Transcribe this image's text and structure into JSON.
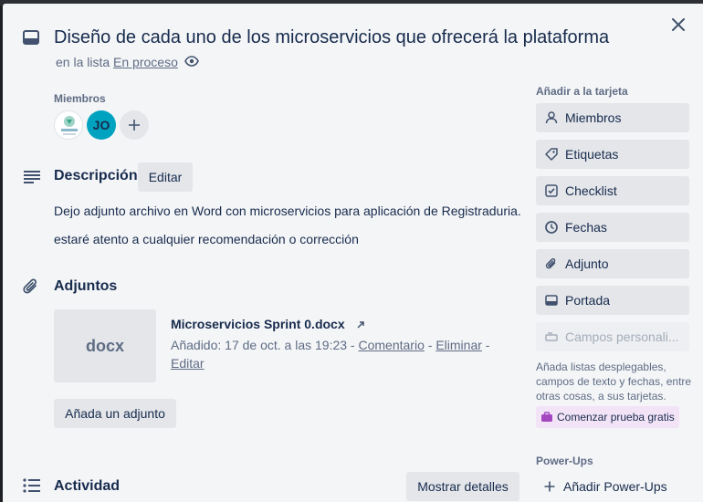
{
  "card": {
    "title": "Diseño de cada uno de los microservicios que ofrecerá la plataforma",
    "list_prefix": "en la lista",
    "list_name": "En proceso"
  },
  "members": {
    "heading": "Miembros",
    "avatars": [
      {
        "initials": ""
      },
      {
        "initials": "JO"
      }
    ]
  },
  "description": {
    "heading": "Descripción",
    "edit_label": "Editar",
    "lines": [
      "Dejo adjunto archivo en Word con microservicios para aplicación de Registraduria.",
      "estaré atento a cualquier recomendación o corrección"
    ]
  },
  "attachments": {
    "heading": "Adjuntos",
    "items": [
      {
        "thumb": "docx",
        "name": "Microservicios Sprint 0.docx",
        "added_label": "Añadido: 17 de oct. a las 19:23",
        "comment_label": "Comentario",
        "delete_label": "Eliminar",
        "edit_label": "Editar"
      }
    ],
    "add_label": "Añada un adjunto"
  },
  "activity": {
    "heading": "Actividad",
    "show_details_label": "Mostrar detalles"
  },
  "sidebar": {
    "add_to_card_heading": "Añadir a la tarjeta",
    "buttons": [
      {
        "label": "Miembros",
        "icon": "person-icon"
      },
      {
        "label": "Etiquetas",
        "icon": "label-icon"
      },
      {
        "label": "Checklist",
        "icon": "checklist-icon"
      },
      {
        "label": "Fechas",
        "icon": "clock-icon"
      },
      {
        "label": "Adjunto",
        "icon": "paperclip-icon"
      },
      {
        "label": "Portada",
        "icon": "cover-icon"
      },
      {
        "label": "Campos personali...",
        "icon": "custom-fields-icon"
      }
    ],
    "helper_text": "Añada listas desplegables, campos de texto y fechas, entre otras cosas, a sus tarjetas.",
    "trial_label": "Comenzar prueba gratis",
    "powerups_heading": "Power-Ups",
    "add_powerups_label": "Añadir Power-Ups"
  },
  "colors": {
    "modal_bg": "#f4f5f7",
    "button_bg": "#e4e6ea",
    "text": "#172b4d",
    "muted": "#5e6c84",
    "avatar_teal": "#00a3bf",
    "trial_bg": "#f3e3f7"
  }
}
